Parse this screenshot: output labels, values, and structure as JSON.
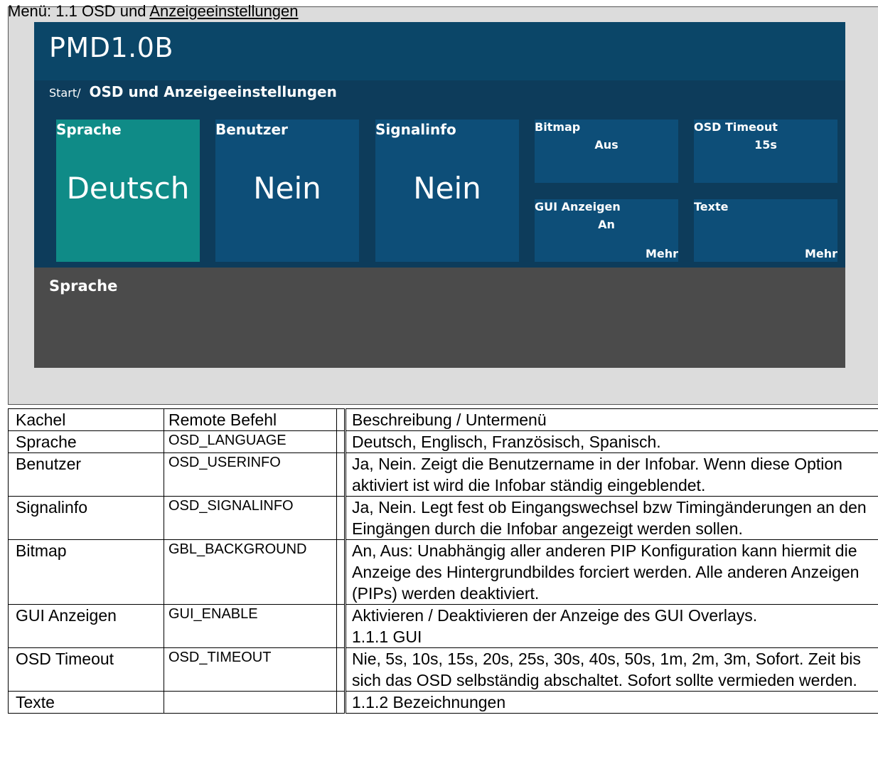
{
  "page_title": {
    "prefix": "Menü: 1.1 OSD und ",
    "underlined": "Anzeigeeinstellungen"
  },
  "osd": {
    "brand": "PMD1.0B",
    "breadcrumb_root": "Start/",
    "breadcrumb_current": "OSD und Anzeigeeinstellungen",
    "tiles": [
      {
        "label": "Sprache",
        "value": "Deutsch"
      },
      {
        "label": "Benutzer",
        "value": "Nein"
      },
      {
        "label": "Signalinfo",
        "value": "Nein"
      },
      {
        "label": "Bitmap",
        "value": "Aus"
      },
      {
        "label": "OSD Timeout",
        "value": "15s"
      },
      {
        "label": "GUI Anzeigen",
        "value": "An",
        "more": "Mehr"
      },
      {
        "label": "Texte",
        "more": "Mehr"
      }
    ],
    "footer_title": "Sprache",
    "colors": {
      "header": "#0b4668",
      "background": "#0d3c5b",
      "tile": "#0d4e78",
      "tile_active": "#0f8b87",
      "footer": "#4b4b4b"
    }
  },
  "table": {
    "headers": {
      "kachel": "Kachel",
      "remote": "Remote Befehl",
      "desc_prefix": "Beschreibung / ",
      "desc_sub": "Untermenü"
    },
    "rows": [
      {
        "kachel": "Sprache",
        "cmd": "OSD_LANGUAGE",
        "desc": "Deutsch, Englisch, Französisch, Spanisch."
      },
      {
        "kachel": "Benutzer",
        "cmd": "OSD_USERINFO",
        "desc": "Ja, Nein. Zeigt die Benutzername in der Infobar. Wenn diese Option aktiviert ist wird die Infobar ständig eingeblendet."
      },
      {
        "kachel": "Signalinfo",
        "cmd": "OSD_SIGNALINFO",
        "desc": "Ja, Nein. Legt fest ob Eingangswechsel bzw Timingänderungen an den Eingängen durch die Infobar angezeigt werden sollen."
      },
      {
        "kachel": "Bitmap",
        "cmd": "GBL_BACKGROUND",
        "desc": "An, Aus: Unabhängig aller anderen PIP Konfiguration kann hiermit die Anzeige des Hintergrundbildes forciert werden. Alle anderen Anzeigen (PIPs) werden deaktiviert."
      },
      {
        "kachel": "GUI Anzeigen",
        "cmd": "GUI_ENABLE",
        "desc": "Aktivieren / Deaktivieren der Anzeige des GUI Overlays.",
        "sub": "1.1.1 GUI"
      },
      {
        "kachel": "OSD Timeout",
        "cmd": "OSD_TIMEOUT",
        "desc": "Nie, 5s, 10s, 15s, 20s, 25s, 30s, 40s, 50s, 1m, 2m, 3m, Sofort. Zeit bis sich das OSD selbständig abschaltet. Sofort sollte vermieden werden."
      },
      {
        "kachel": "Texte",
        "cmd": "",
        "desc": "",
        "sub": "1.1.2 Bezeichnungen"
      }
    ]
  }
}
